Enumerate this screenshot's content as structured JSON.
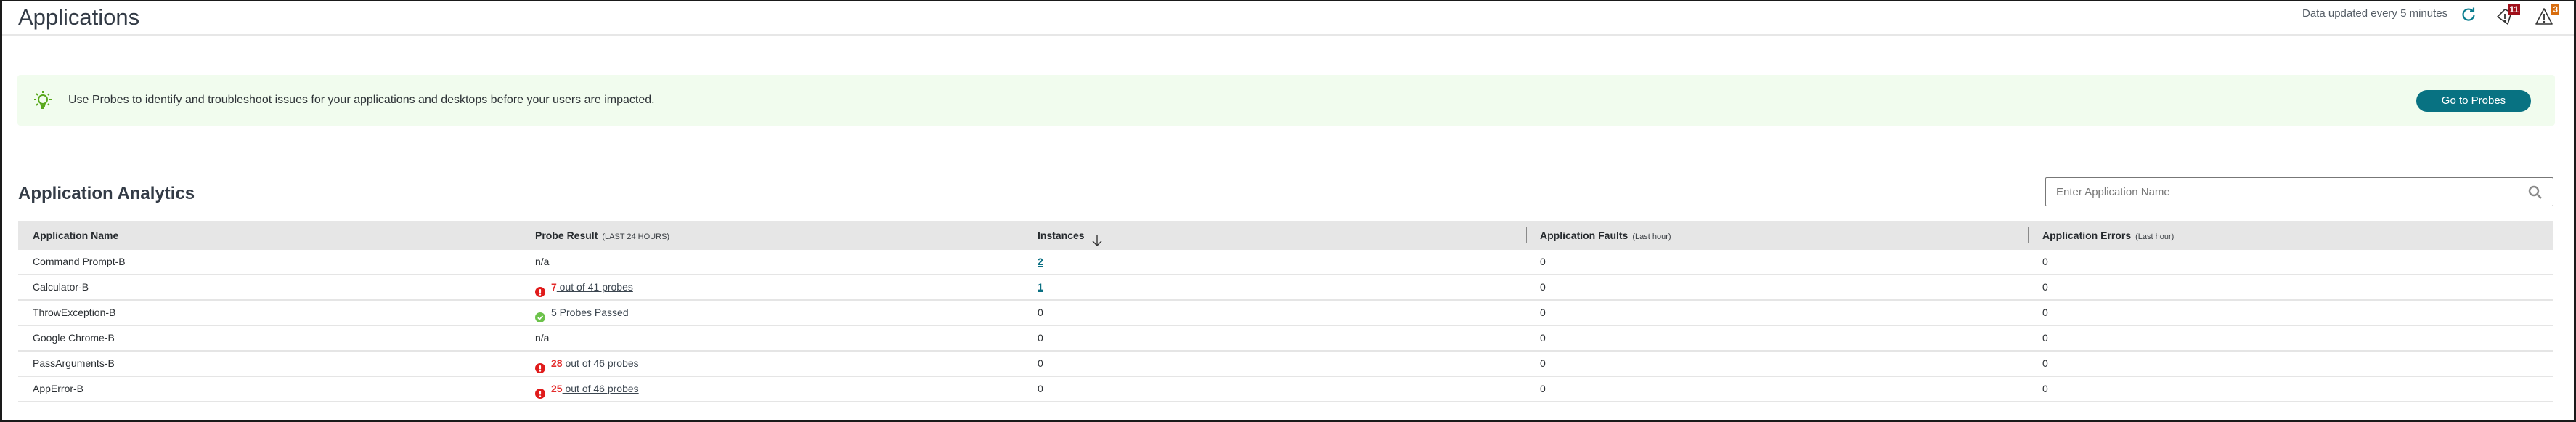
{
  "header": {
    "title": "Applications",
    "update_text": "Data updated every 5 minutes",
    "notifications": [
      {
        "icon": "alert-tag-icon",
        "count": "11",
        "color": "#a00f1a"
      },
      {
        "icon": "warning-triangle-icon",
        "count": "3",
        "color": "#d86d0f"
      }
    ]
  },
  "banner": {
    "icon": "lightbulb-icon",
    "text": "Use Probes to identify and troubleshoot issues for your applications and desktops before your users are impacted.",
    "button_label": "Go to Probes"
  },
  "analytics": {
    "title": "Application Analytics",
    "search_placeholder": "Enter Application Name",
    "search_value": "",
    "columns": [
      {
        "label": "Application Name",
        "sub": ""
      },
      {
        "label": "Probe Result",
        "sub": "(LAST 24 HOURS)"
      },
      {
        "label": "Instances",
        "sub": "",
        "sort": "descending"
      },
      {
        "label": "Application Faults",
        "sub": "(Last hour)"
      },
      {
        "label": "Application Errors",
        "sub": "(Last hour)"
      }
    ],
    "rows": [
      {
        "name": "Command Prompt-B",
        "probe_status": "none",
        "probe_count": "",
        "probe_text": "n/a",
        "instances": "2",
        "instances_link": true,
        "faults": "0",
        "errors": "0"
      },
      {
        "name": "Calculator-B",
        "probe_status": "fail",
        "probe_count": "7",
        "probe_text": " out of 41 probes",
        "instances": "1",
        "instances_link": true,
        "faults": "0",
        "errors": "0"
      },
      {
        "name": "ThrowException-B",
        "probe_status": "pass",
        "probe_count": "",
        "probe_text": "5 Probes Passed",
        "instances": "0",
        "instances_link": false,
        "faults": "0",
        "errors": "0"
      },
      {
        "name": "Google Chrome-B",
        "probe_status": "none",
        "probe_count": "",
        "probe_text": "n/a",
        "instances": "0",
        "instances_link": false,
        "faults": "0",
        "errors": "0"
      },
      {
        "name": "PassArguments-B",
        "probe_status": "fail",
        "probe_count": "28",
        "probe_text": " out of 46 probes",
        "instances": "0",
        "instances_link": false,
        "faults": "0",
        "errors": "0"
      },
      {
        "name": "AppError-B",
        "probe_status": "fail",
        "probe_count": "25",
        "probe_text": " out of 46 probes",
        "instances": "0",
        "instances_link": false,
        "faults": "0",
        "errors": "0"
      }
    ]
  },
  "colors": {
    "accent": "#087282",
    "banner_bg": "#f1fcee",
    "fail": "#e32b2b",
    "pass": "#6cc24a"
  }
}
